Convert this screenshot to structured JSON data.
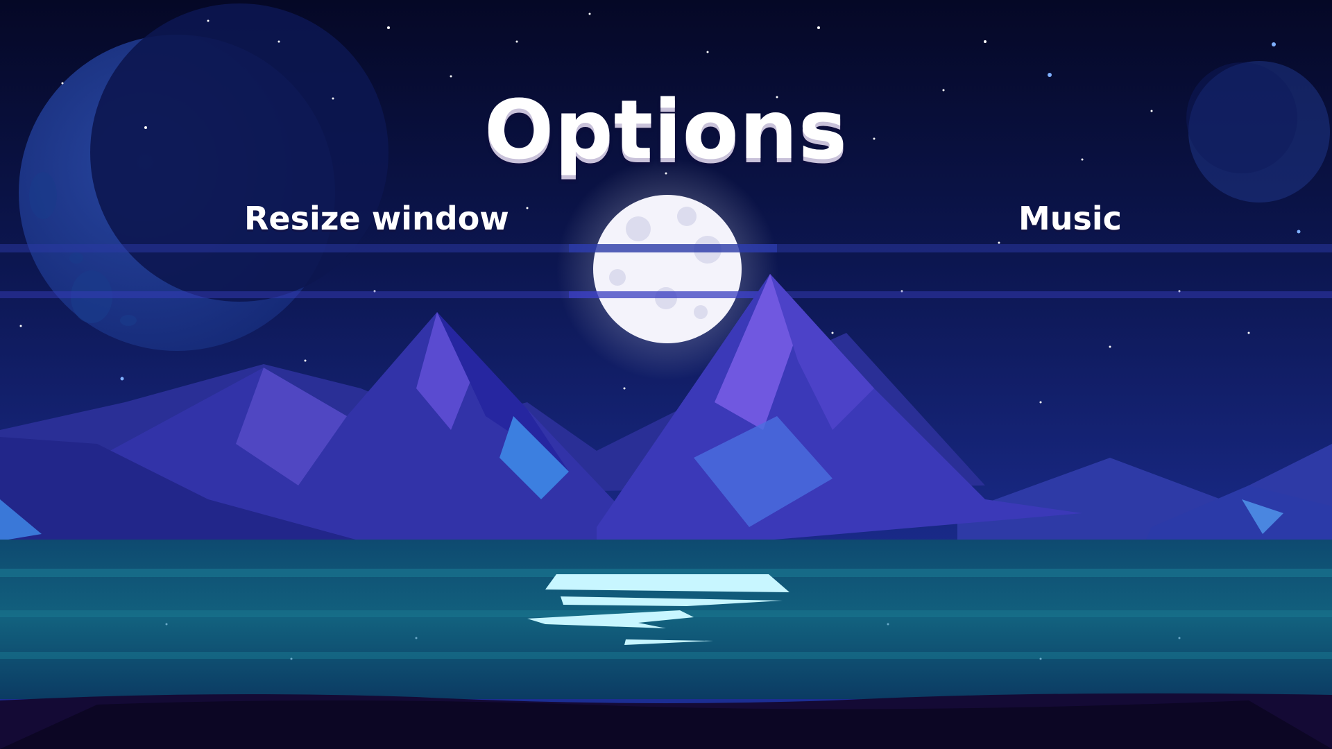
{
  "menu": {
    "title": "Options",
    "items": [
      {
        "label": "Resize window"
      },
      {
        "label": "Music"
      }
    ]
  },
  "scene": {
    "description_icons": [
      "crescent-moon-icon",
      "full-moon-icon",
      "planet-icon"
    ],
    "colors": {
      "sky_top": "#060a2a",
      "sky_bottom": "#1a2a8e",
      "mountain_dark": "#2a2a9a",
      "mountain_light": "#6b55d8",
      "water": "#0f5c7e",
      "moon": "#f4f3fb",
      "shore": "#12082e"
    }
  }
}
